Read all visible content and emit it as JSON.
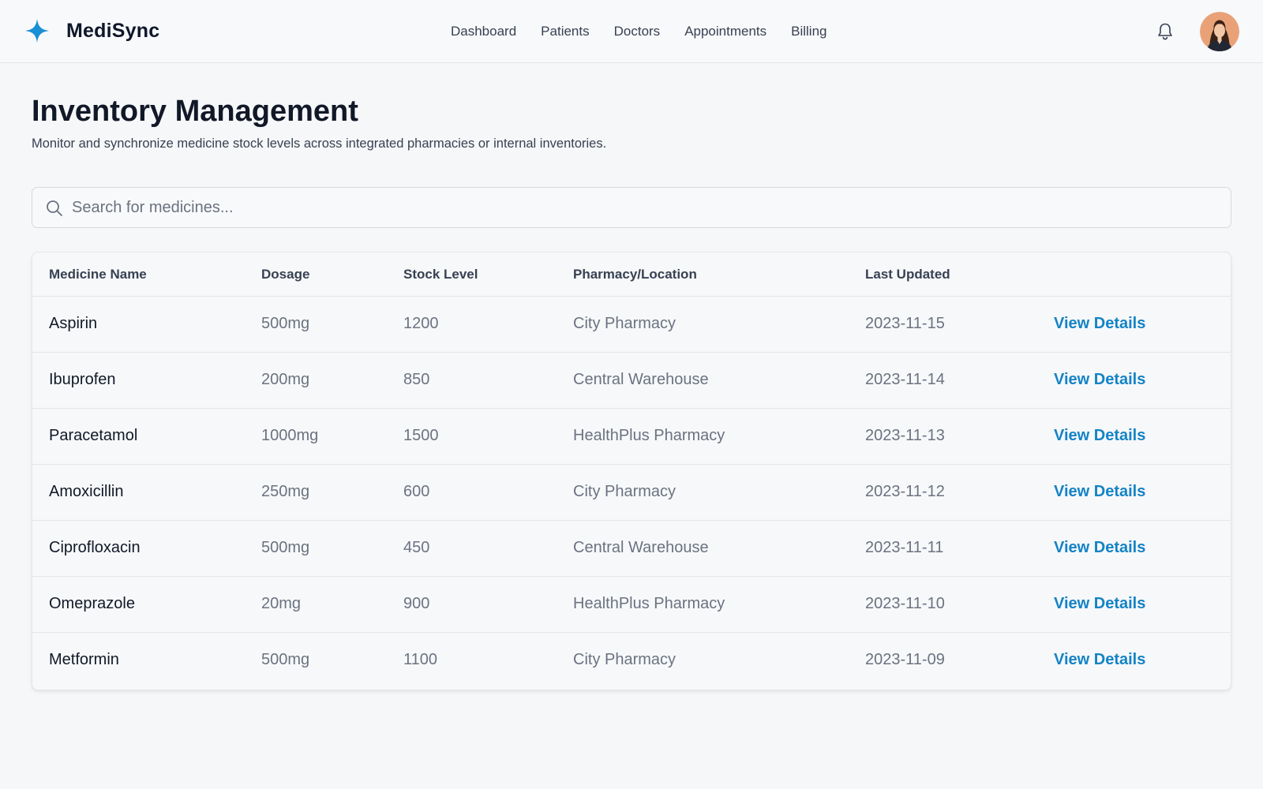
{
  "app": {
    "brand_name": "MediSync",
    "accent_color": "#1483c6"
  },
  "nav": {
    "items": [
      {
        "label": "Dashboard"
      },
      {
        "label": "Patients"
      },
      {
        "label": "Doctors"
      },
      {
        "label": "Appointments"
      },
      {
        "label": "Billing"
      }
    ]
  },
  "header_icons": {
    "notifications": "bell-icon",
    "profile": "user-avatar"
  },
  "page": {
    "title": "Inventory Management",
    "subtitle": "Monitor and synchronize medicine stock levels across integrated pharmacies or internal inventories."
  },
  "search": {
    "placeholder": "Search for medicines...",
    "value": ""
  },
  "table": {
    "columns": [
      "Medicine Name",
      "Dosage",
      "Stock Level",
      "Pharmacy/Location",
      "Last Updated"
    ],
    "rows": [
      {
        "name": "Aspirin",
        "dosage": "500mg",
        "stock": "1200",
        "location": "City Pharmacy",
        "updated": "2023-11-15",
        "action": "View Details"
      },
      {
        "name": "Ibuprofen",
        "dosage": "200mg",
        "stock": "850",
        "location": "Central Warehouse",
        "updated": "2023-11-14",
        "action": "View Details"
      },
      {
        "name": "Paracetamol",
        "dosage": "1000mg",
        "stock": "1500",
        "location": "HealthPlus Pharmacy",
        "updated": "2023-11-13",
        "action": "View Details"
      },
      {
        "name": "Amoxicillin",
        "dosage": "250mg",
        "stock": "600",
        "location": "City Pharmacy",
        "updated": "2023-11-12",
        "action": "View Details"
      },
      {
        "name": "Ciprofloxacin",
        "dosage": "500mg",
        "stock": "450",
        "location": "Central Warehouse",
        "updated": "2023-11-11",
        "action": "View Details"
      },
      {
        "name": "Omeprazole",
        "dosage": "20mg",
        "stock": "900",
        "location": "HealthPlus Pharmacy",
        "updated": "2023-11-10",
        "action": "View Details"
      },
      {
        "name": "Metformin",
        "dosage": "500mg",
        "stock": "1100",
        "location": "City Pharmacy",
        "updated": "2023-11-09",
        "action": "View Details"
      }
    ]
  }
}
